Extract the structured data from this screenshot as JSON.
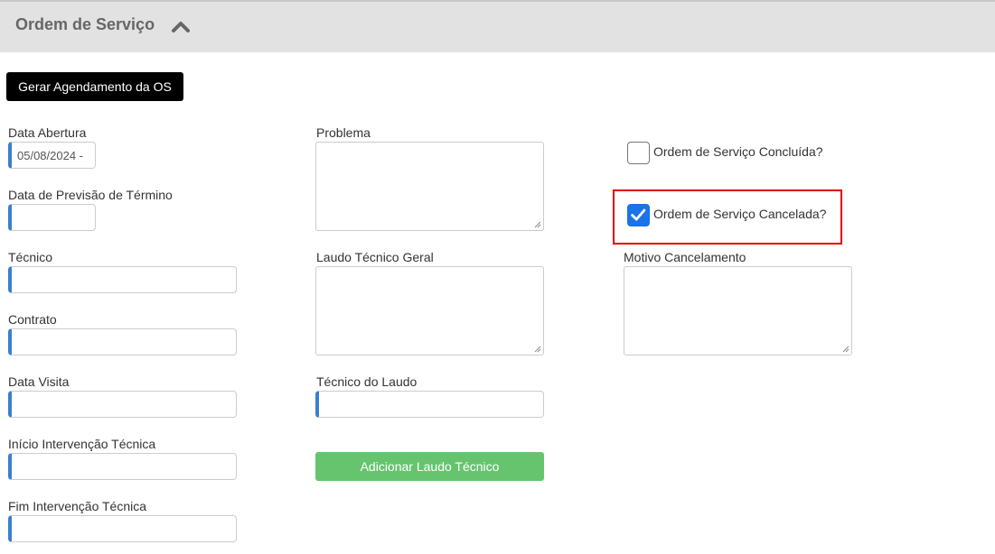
{
  "header": {
    "title": "Ordem de Serviço",
    "collapse_icon": "chevron-up-icon"
  },
  "actions": {
    "schedule_button": "Gerar Agendamento da OS",
    "add_report_button": "Adicionar Laudo Técnico"
  },
  "left_column": {
    "data_abertura": {
      "label": "Data Abertura",
      "value": "05/08/2024 -"
    },
    "data_previsao": {
      "label": "Data de Previsão de Término",
      "value": ""
    },
    "tecnico": {
      "label": "Técnico",
      "value": ""
    },
    "contrato": {
      "label": "Contrato",
      "value": ""
    },
    "data_visita": {
      "label": "Data Visita",
      "value": ""
    },
    "inicio_intervencao": {
      "label": "Início Intervenção Técnica",
      "value": ""
    },
    "fim_intervencao": {
      "label": "Fim Intervenção Técnica",
      "value": ""
    }
  },
  "middle_column": {
    "problema": {
      "label": "Problema",
      "value": ""
    },
    "laudo_geral": {
      "label": "Laudo Técnico Geral",
      "value": ""
    },
    "tecnico_laudo": {
      "label": "Técnico do Laudo",
      "value": ""
    }
  },
  "right_column": {
    "concluida": {
      "label": "Ordem de Serviço Concluída?",
      "checked": false
    },
    "cancelada": {
      "label": "Ordem de Serviço Cancelada?",
      "checked": true
    },
    "motivo_cancelamento": {
      "label": "Motivo Cancelamento",
      "value": ""
    }
  },
  "colors": {
    "accent": "#3a7fd0",
    "checkbox_checked": "#1a73e8",
    "highlight_border": "#e00000",
    "success_button": "#66c46f",
    "header_bg": "#e2e2e2"
  }
}
